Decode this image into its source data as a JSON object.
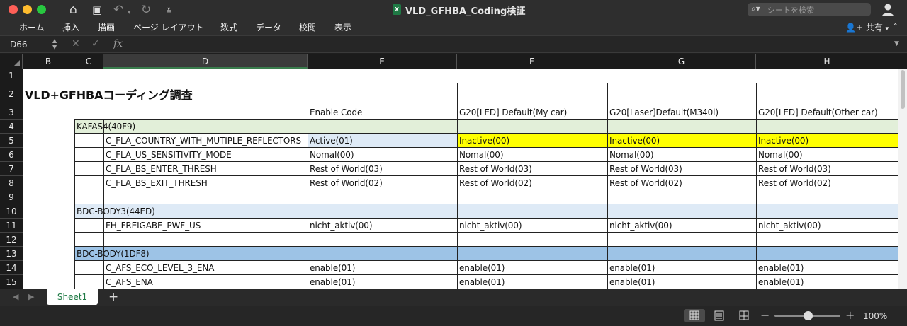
{
  "window": {
    "title": "VLD_GFHBA_Coding検証",
    "search_placeholder": "シートを検索",
    "file_icon_label": "X"
  },
  "ribbon": {
    "tabs": [
      "ホーム",
      "挿入",
      "描画",
      "ページ レイアウト",
      "数式",
      "データ",
      "校閲",
      "表示"
    ],
    "share_label": "共有"
  },
  "formula_bar": {
    "name_box": "D66",
    "fx_label": "fx",
    "formula": ""
  },
  "columns": [
    "B",
    "C",
    "D",
    "E",
    "F",
    "G",
    "H"
  ],
  "selected_column": "D",
  "colors": {
    "green_row": "#e2efd9",
    "light_blue_row": "#deeaf6",
    "blue_row": "#9dc3e6",
    "yellow": "#ffff00",
    "active_code": "#deeaf6"
  },
  "rows": [
    {
      "num": "1",
      "cells": {}
    },
    {
      "num": "2",
      "cells": {
        "B": "VLD+GFHBAコーディング調査"
      }
    },
    {
      "num": "3",
      "cells": {
        "E": "Enable Code",
        "F": "G20[LED] Default(My car)",
        "G": "G20[Laser]Default(M340i)",
        "H": "G20[LED] Default(Other car)"
      }
    },
    {
      "num": "4",
      "cells": {
        "C": "KAFAS4(40F9)"
      }
    },
    {
      "num": "5",
      "cells": {
        "D": "C_FLA_COUNTRY_WITH_MUTIPLE_REFLECTORS",
        "E": "Active(01)",
        "F": "Inactive(00)",
        "G": "Inactive(00)",
        "H": "Inactive(00)"
      }
    },
    {
      "num": "6",
      "cells": {
        "D": "C_FLA_US_SENSITIVITY_MODE",
        "E": "Nomal(00)",
        "F": "Nomal(00)",
        "G": "Nomal(00)",
        "H": "Nomal(00)"
      }
    },
    {
      "num": "7",
      "cells": {
        "D": "C_FLA_BS_ENTER_THRESH",
        "E": "Rest of World(03)",
        "F": "Rest of World(03)",
        "G": "Rest of World(03)",
        "H": "Rest of World(03)"
      }
    },
    {
      "num": "8",
      "cells": {
        "D": "C_FLA_BS_EXIT_THRESH",
        "E": "Rest of World(02)",
        "F": "Rest of World(02)",
        "G": "Rest of World(02)",
        "H": "Rest of World(02)"
      }
    },
    {
      "num": "9",
      "cells": {}
    },
    {
      "num": "10",
      "cells": {
        "C": "BDC-BODY3(44ED)"
      }
    },
    {
      "num": "11",
      "cells": {
        "D": "FH_FREIGABE_PWF_US",
        "E": "nicht_aktiv(00)",
        "F": "nicht_aktiv(00)",
        "G": "nicht_aktiv(00)",
        "H": "nicht_aktiv(00)"
      }
    },
    {
      "num": "12",
      "cells": {}
    },
    {
      "num": "13",
      "cells": {
        "C": "BDC-BODY(1DF8)"
      }
    },
    {
      "num": "14",
      "cells": {
        "D": "C_AFS_ECO_LEVEL_3_ENA",
        "E": "enable(01)",
        "F": "enable(01)",
        "G": "enable(01)",
        "H": "enable(01)"
      }
    },
    {
      "num": "15",
      "cells": {
        "D": "C_AFS_ENA",
        "E": "enable(01)",
        "F": "enable(01)",
        "G": "enable(01)",
        "H": "enable(01)"
      }
    }
  ],
  "sheet_tabs": [
    "Sheet1"
  ],
  "status": {
    "zoom": "100%",
    "zoom_level": 0.5
  }
}
